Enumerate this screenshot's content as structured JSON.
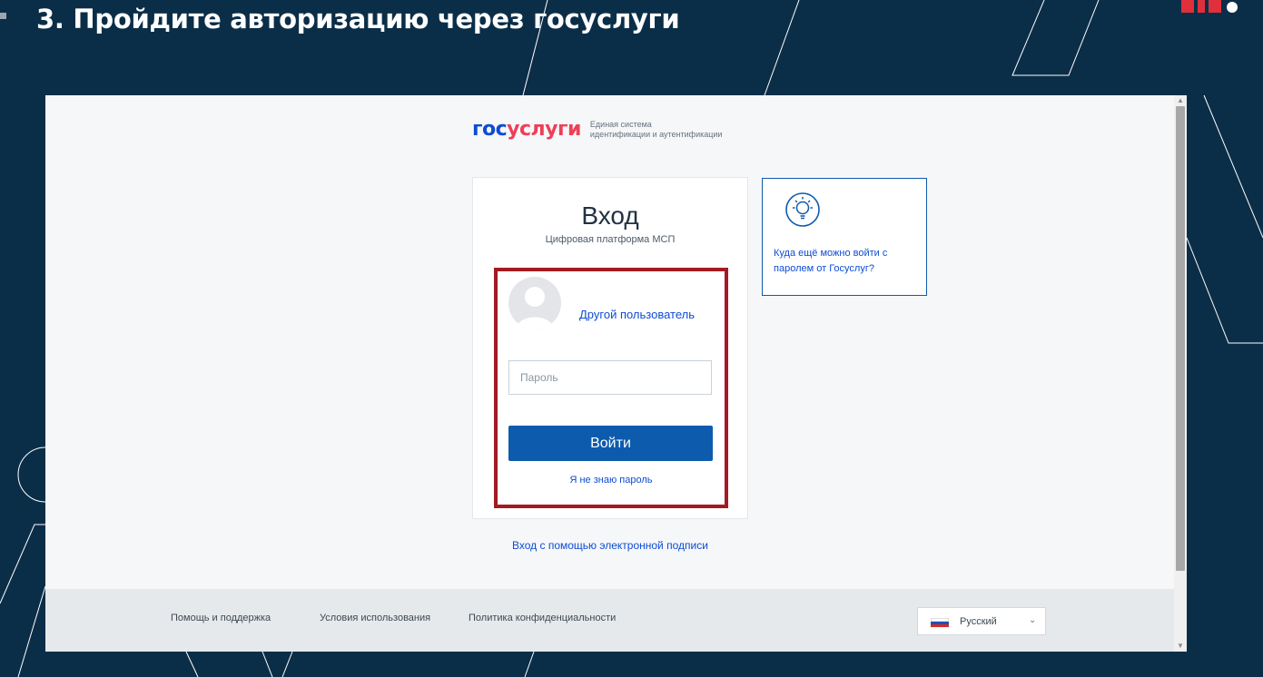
{
  "slide": {
    "title": "3. Пройдите авторизацию через госуслуги"
  },
  "logo": {
    "gos": "гос",
    "uslugi": "услуги",
    "subtitle_line1": "Единая система",
    "subtitle_line2": "идентификации и аутентификации"
  },
  "login": {
    "title": "Вход",
    "subtitle": "Цифровая платформа МСП",
    "other_user_link": "Другой пользователь",
    "password_placeholder": "Пароль",
    "login_button": "Войти",
    "forgot_link": "Я не знаю пароль"
  },
  "info_card": {
    "text": "Куда ещё можно войти с паролем от Госуслуг?",
    "icon": "lightbulb-icon"
  },
  "eds_link": "Вход с помощью электронной подписи",
  "footer": {
    "links": [
      "Помощь и поддержка",
      "Условия использования",
      "Политика конфиденциальности"
    ],
    "language": "Русский"
  },
  "colors": {
    "slide_background": "#0b2e48",
    "gosuslugi_blue": "#0d4cd3",
    "gosuslugi_red": "#ee3f58",
    "button_blue": "#0d5bad",
    "highlight_border": "#a31a22"
  }
}
